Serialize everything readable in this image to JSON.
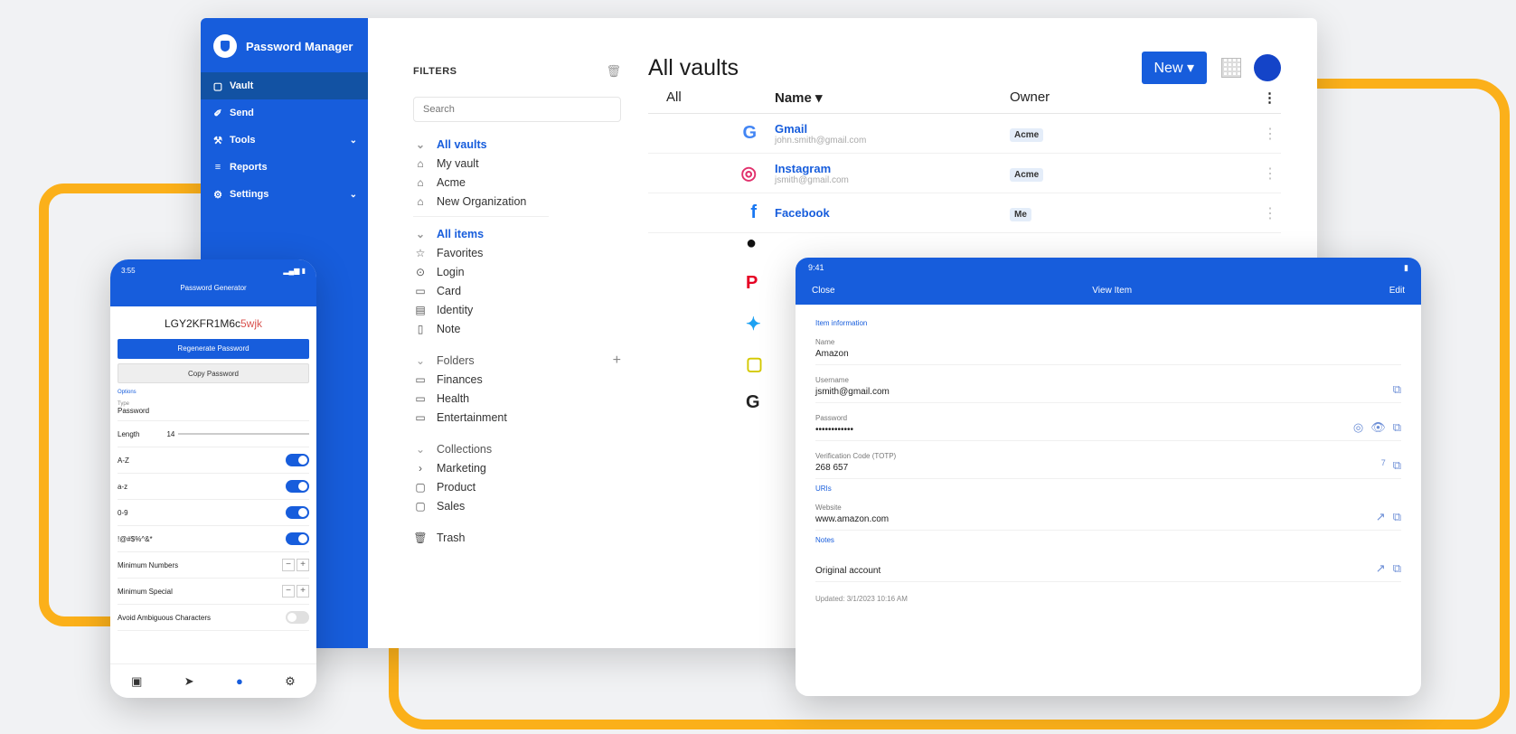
{
  "desktop": {
    "brand": "Password Manager",
    "nav": [
      {
        "icon": "vault-icon",
        "glyph": "▢",
        "label": "Vault",
        "active": true
      },
      {
        "icon": "send-icon",
        "glyph": "✐",
        "label": "Send"
      },
      {
        "icon": "tools-icon",
        "glyph": "⚒",
        "label": "Tools",
        "chevron": true
      },
      {
        "icon": "reports-icon",
        "glyph": "≡",
        "label": "Reports"
      },
      {
        "icon": "settings-icon",
        "glyph": "⚙",
        "label": "Settings",
        "chevron": true
      }
    ],
    "filters": {
      "title": "FILTERS",
      "search_placeholder": "Search",
      "vaults_head": "All vaults",
      "vaults": [
        "My vault",
        "Acme",
        "New Organization"
      ],
      "items_head": "All items",
      "items": [
        "Favorites",
        "Login",
        "Card",
        "Identity",
        "Note"
      ],
      "folders_head": "Folders",
      "folders": [
        "Finances",
        "Health",
        "Entertainment"
      ],
      "collections_head": "Collections",
      "collections": [
        "Marketing",
        "Product",
        "Sales"
      ],
      "trash": "Trash"
    },
    "main": {
      "title": "All vaults",
      "new_label": "New",
      "col_all": "All",
      "col_name": "Name",
      "col_owner": "Owner",
      "rows": [
        {
          "icon": "G",
          "color": "#4285f4",
          "name": "Gmail",
          "sub": "john.smith@gmail.com",
          "owner": "Acme"
        },
        {
          "icon": "◎",
          "color": "#e1306c",
          "name": "Instagram",
          "sub": "jsmith@gmail.com",
          "owner": "Acme"
        },
        {
          "icon": "f",
          "color": "#1877f2",
          "name": "Facebook",
          "sub": "",
          "owner": "Me"
        }
      ]
    }
  },
  "tablet": {
    "status_time": "9:41",
    "nav_left": "Close",
    "nav_title": "View Item",
    "nav_right": "Edit",
    "section_info": "Item information",
    "name_label": "Name",
    "name_value": "Amazon",
    "username_label": "Username",
    "username_value": "jsmith@gmail.com",
    "password_label": "Password",
    "password_value": "••••••••••••",
    "totp_label": "Verification Code (TOTP)",
    "totp_value": "268 657",
    "totp_timer": "7",
    "section_urls": "URIs",
    "website_label": "Website",
    "website_value": "www.amazon.com",
    "section_notes": "Notes",
    "notes_value": "Original account",
    "updated": "Updated: 3/1/2023 10:16 AM"
  },
  "phone": {
    "status_time": "3:55",
    "title": "Password Generator",
    "password_main": "LGY2KFR1M6c",
    "password_tail": "5wjk",
    "regen_label": "Regenerate Password",
    "copy_label": "Copy Password",
    "options_head": "Options",
    "type_label": "Type",
    "type_value": "Password",
    "length_label": "Length",
    "length_value": "14",
    "toggles": [
      "A-Z",
      "a-z",
      "0-9",
      "!@#$%^&*"
    ],
    "min_numbers": "Minimum Numbers",
    "min_special": "Minimum Special",
    "avoid_ambiguous": "Avoid Ambiguous Characters",
    "tabs": [
      "Vault",
      "Send",
      "Generator",
      "Settings"
    ]
  }
}
